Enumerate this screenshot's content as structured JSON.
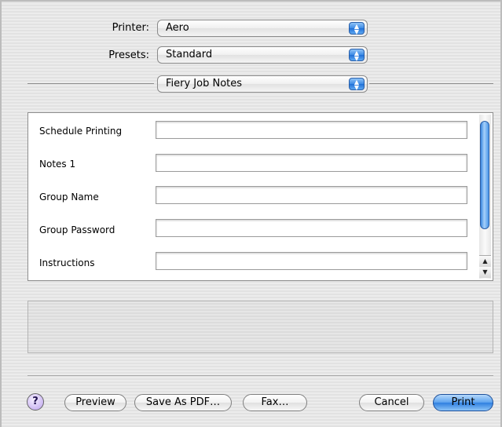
{
  "printer": {
    "label": "Printer:",
    "value": "Aero"
  },
  "presets": {
    "label": "Presets:",
    "value": "Standard"
  },
  "pane": {
    "value": "Fiery Job Notes"
  },
  "fields": [
    {
      "label": "Schedule Printing",
      "value": ""
    },
    {
      "label": "Notes 1",
      "value": ""
    },
    {
      "label": "Group Name",
      "value": ""
    },
    {
      "label": "Group Password",
      "value": ""
    },
    {
      "label": "Instructions",
      "value": ""
    }
  ],
  "stepper_icon": "up-down-arrows",
  "buttons": {
    "help": "?",
    "preview": "Preview",
    "save_pdf": "Save As PDF…",
    "fax": "Fax…",
    "cancel": "Cancel",
    "print": "Print"
  },
  "colors": {
    "accent": "#3b8ae5"
  }
}
